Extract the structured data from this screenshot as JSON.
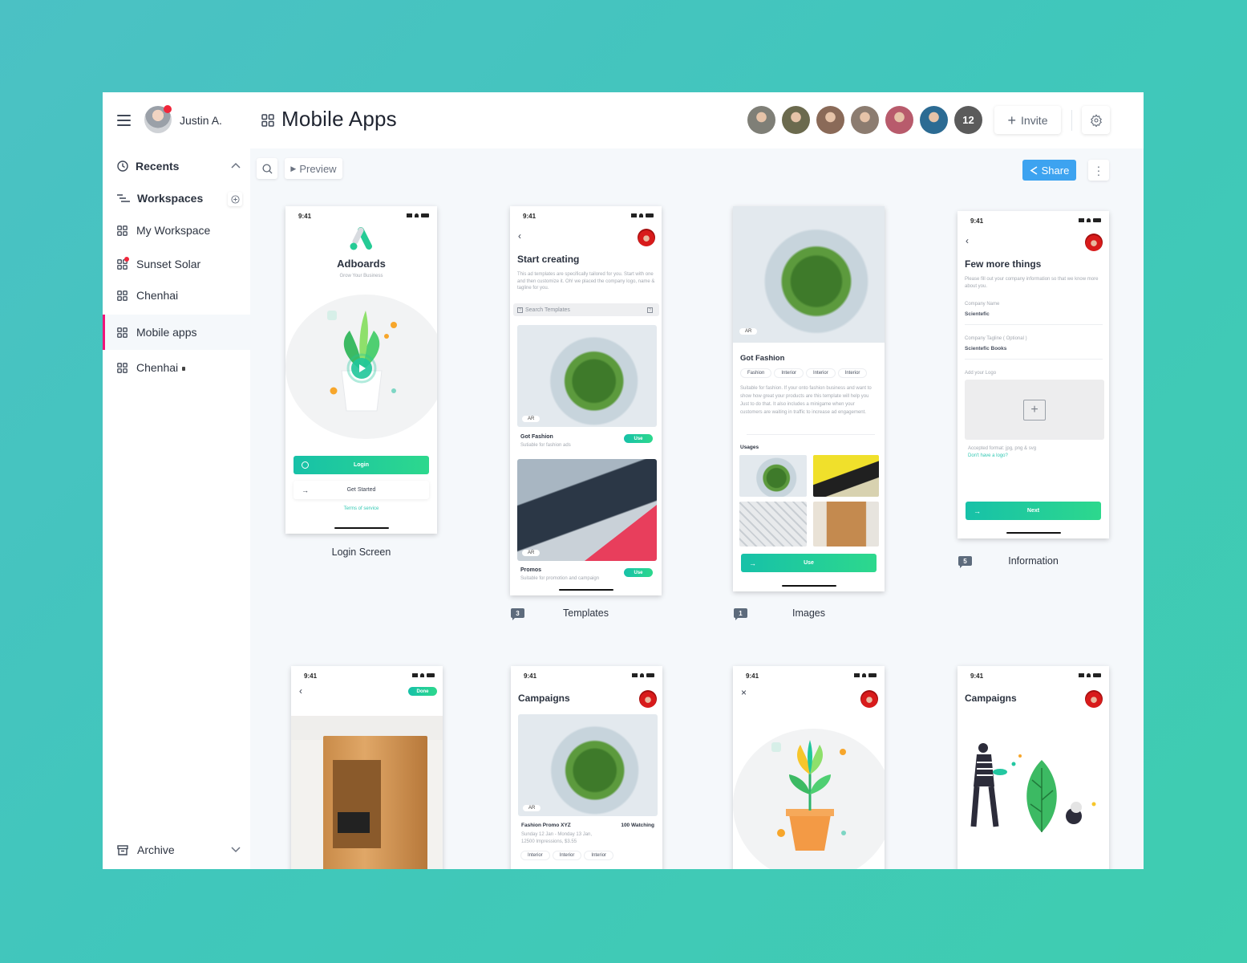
{
  "header": {
    "user_name": "Justin A.",
    "page_title": "Mobile Apps",
    "collaborators": [
      {
        "name": "avatar-1",
        "color": "#7f7f77"
      },
      {
        "name": "avatar-2",
        "color": "#6b6a4e"
      },
      {
        "name": "avatar-3",
        "color": "#8a6a58"
      },
      {
        "name": "avatar-4",
        "color": "#8c7c70"
      },
      {
        "name": "avatar-5",
        "color": "#b85b6c"
      },
      {
        "name": "avatar-6",
        "color": "#2c6b93"
      }
    ],
    "collaborator_overflow": "12",
    "invite_label": "Invite"
  },
  "sidebar": {
    "recents_label": "Recents",
    "workspaces_label": "Workspaces",
    "items": [
      {
        "label": "My Workspace",
        "notification": false,
        "locked": false,
        "active": false
      },
      {
        "label": "Sunset Solar",
        "notification": true,
        "locked": false,
        "active": false
      },
      {
        "label": "Chenhai",
        "notification": false,
        "locked": false,
        "active": false
      },
      {
        "label": "Mobile apps",
        "notification": false,
        "locked": false,
        "active": true
      },
      {
        "label": "Chenhai",
        "notification": false,
        "locked": true,
        "active": false
      }
    ],
    "archive_label": "Archive"
  },
  "toolbar": {
    "preview_label": "Preview",
    "share_label": "Share"
  },
  "accent": {
    "brand": "#1fc9a0",
    "share": "#3da3f0",
    "active_marker": "#f0147a"
  },
  "screens": [
    {
      "caption": "Login Screen",
      "comments": null,
      "time": "9:41",
      "app_name": "Adboards",
      "tagline": "Grow Your Business",
      "login": "Login",
      "get_started": "Get Started",
      "terms": "Terms of service"
    },
    {
      "caption": "Templates",
      "comments": "3",
      "time": "9:41",
      "title": "Start creating",
      "desc": "This ad templates are specifically tailored for you. Start with one and then customize it. Oh! we placed the company logo, name & tagline for you.",
      "search_placeholder": "Search Templates",
      "cards": [
        {
          "title": "Got Fashion",
          "sub": "Sutiable for fashion ads",
          "badge": "AR",
          "action": "Use"
        },
        {
          "title": "Promos",
          "sub": "Suitable for promotion and campaign",
          "badge": "AR",
          "action": "Use"
        }
      ]
    },
    {
      "caption": "Images",
      "comments": "1",
      "time": "",
      "badge": "AR",
      "title": "Got Fashion",
      "tags": [
        "Fashion",
        "Interior",
        "Interior",
        "Interior"
      ],
      "desc": "Suitable for fashion. If your onto fashion business and want to show how great your products are this template will help you Just to do that. It also includes a minigame when your customers are waiting in traffic to increase ad engagement.",
      "usages_label": "Usages",
      "action": "Use"
    },
    {
      "caption": "Information",
      "comments": "5",
      "time": "9:41",
      "title": "Few more things",
      "desc": "Please fill out your company information so that we know more about you.",
      "fields": [
        {
          "label": "Company Name",
          "value": "Scientefic"
        },
        {
          "label": "Company Tagline ( Optional )",
          "value": "Scientefic Books"
        }
      ],
      "logo_label": "Add your Logo",
      "formats": "Accepted format: jpg, png & svg",
      "no_logo": "Don't have a logo?",
      "action": "Next"
    },
    {
      "time": "9:41",
      "done": "Done"
    },
    {
      "time": "9:41",
      "title": "Campaigns",
      "badge": "AR",
      "promo_title": "Fashion Promo XYZ",
      "watching": "100 Watching",
      "promo_dates": "Sunday 12 Jan - Monday 13 Jan,",
      "promo_stats": "12500 Impressions, $3.55",
      "tags": [
        "Interior",
        "Interior",
        "Interior"
      ]
    },
    {
      "time": "9:41",
      "close": "×"
    },
    {
      "time": "9:41",
      "title": "Campaigns"
    }
  ]
}
